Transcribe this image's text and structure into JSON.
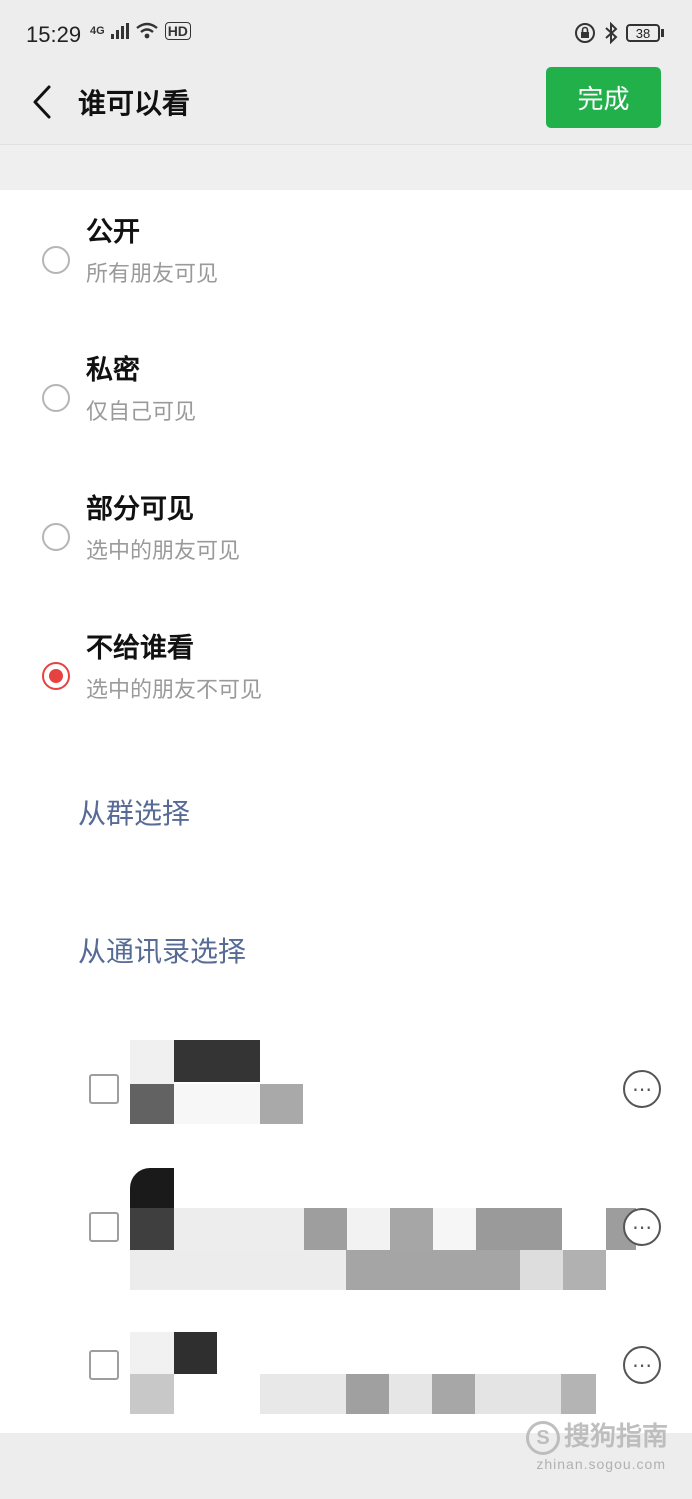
{
  "status": {
    "time": "15:29",
    "network": "4G",
    "hd": "HD",
    "battery": "38"
  },
  "header": {
    "title": "谁可以看",
    "done_label": "完成"
  },
  "options": [
    {
      "title": "公开",
      "subtitle": "所有朋友可见",
      "selected": false
    },
    {
      "title": "私密",
      "subtitle": "仅自己可见",
      "selected": false
    },
    {
      "title": "部分可见",
      "subtitle": "选中的朋友可见",
      "selected": false
    },
    {
      "title": "不给谁看",
      "subtitle": "选中的朋友不可见",
      "selected": true
    }
  ],
  "links": {
    "from_group": "从群选择",
    "from_contacts": "从通讯录选择"
  },
  "contacts": [
    {
      "checked": false,
      "name_obscured": true
    },
    {
      "checked": false,
      "name_obscured": true
    },
    {
      "checked": false,
      "name_obscured": true
    }
  ],
  "watermark": {
    "brand": "搜狗指南",
    "url": "zhinan.sogou.com"
  },
  "colors": {
    "accent_green": "#22b04b",
    "radio_selected": "#e64340",
    "link_blue": "#576b95"
  }
}
